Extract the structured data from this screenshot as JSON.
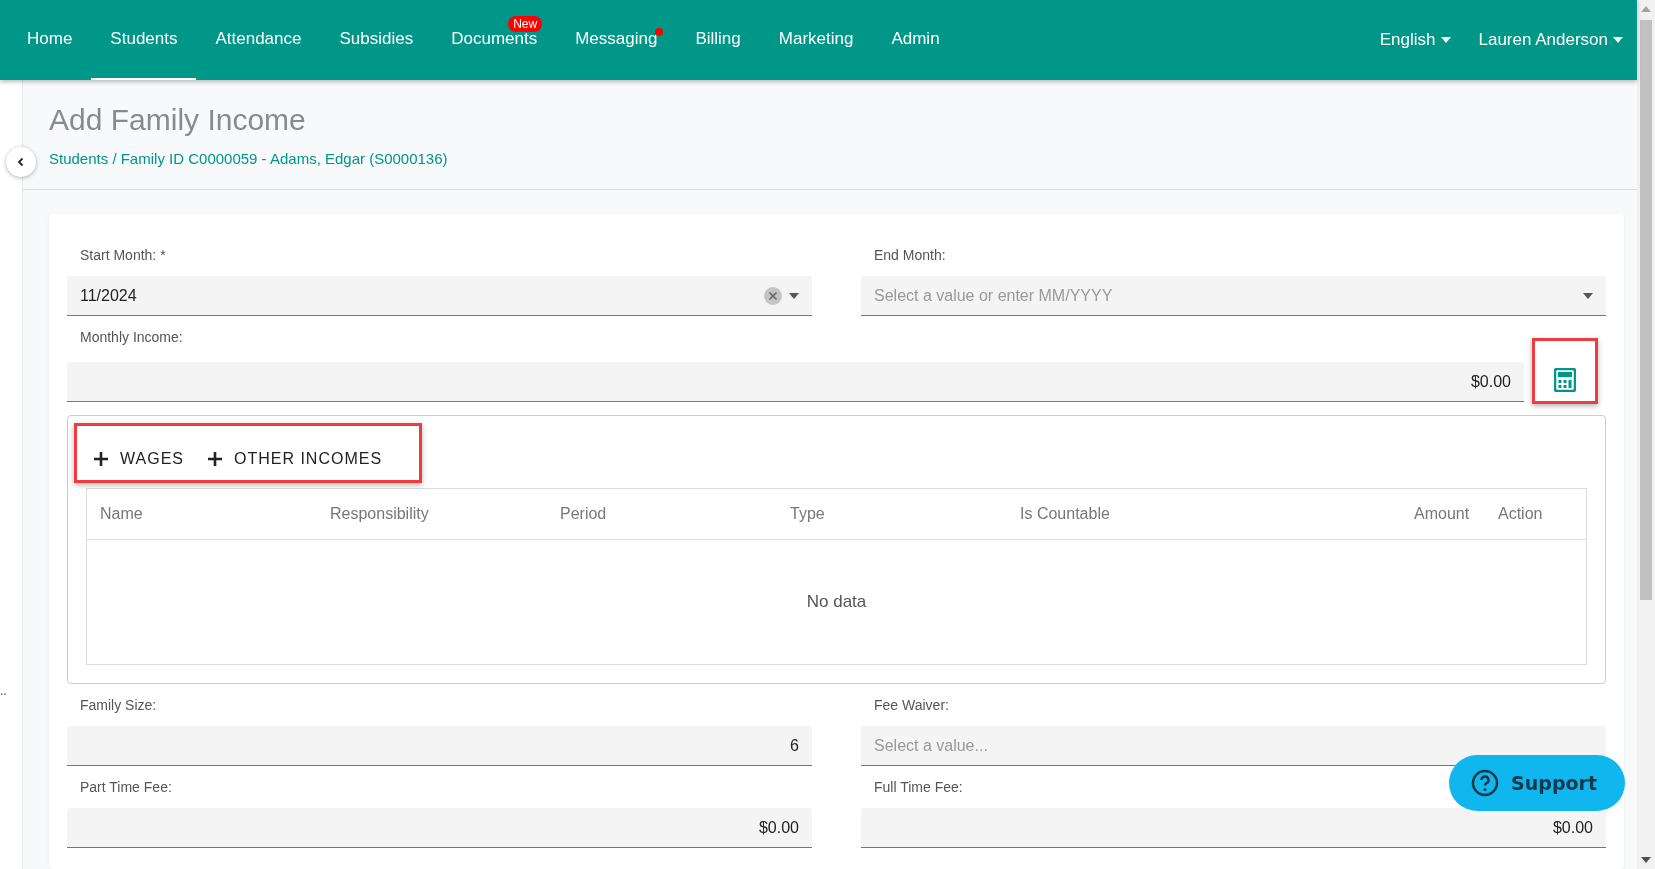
{
  "nav": {
    "tabs": [
      {
        "label": "Home",
        "selected": false
      },
      {
        "label": "Students",
        "selected": true
      },
      {
        "label": "Attendance",
        "selected": false
      },
      {
        "label": "Subsidies",
        "selected": false
      },
      {
        "label": "Documents",
        "selected": false,
        "badge": "New"
      },
      {
        "label": "Messaging",
        "selected": false,
        "dot": true
      },
      {
        "label": "Billing",
        "selected": false
      },
      {
        "label": "Marketing",
        "selected": false
      },
      {
        "label": "Admin",
        "selected": false
      }
    ],
    "language": "English",
    "user": "Lauren Anderson"
  },
  "sidebar": {
    "more": ".."
  },
  "page": {
    "title": "Add Family Income",
    "breadcrumb": "Students / Family ID C0000059 - Adams, Edgar (S0000136)"
  },
  "form": {
    "start_month": {
      "label": "Start Month: *",
      "value": "11/2024"
    },
    "end_month": {
      "label": "End Month:",
      "placeholder": "Select a value or enter MM/YYYY"
    },
    "monthly_income": {
      "label": "Monthly Income:",
      "value": "$0.00"
    },
    "income_actions": [
      "WAGES",
      "OTHER INCOMES"
    ],
    "table": {
      "columns": [
        "Name",
        "Responsibility",
        "Period",
        "Type",
        "Is Countable",
        "Amount",
        "Action"
      ],
      "empty": "No data"
    },
    "family_size": {
      "label": "Family Size:",
      "value": "6"
    },
    "fee_waiver": {
      "label": "Fee Waiver:",
      "placeholder": "Select a value..."
    },
    "part_time_fee": {
      "label": "Part Time Fee:",
      "value": "$0.00"
    },
    "full_time_fee": {
      "label": "Full Time Fee:",
      "value": "$0.00"
    }
  },
  "support": {
    "label": "Support"
  }
}
